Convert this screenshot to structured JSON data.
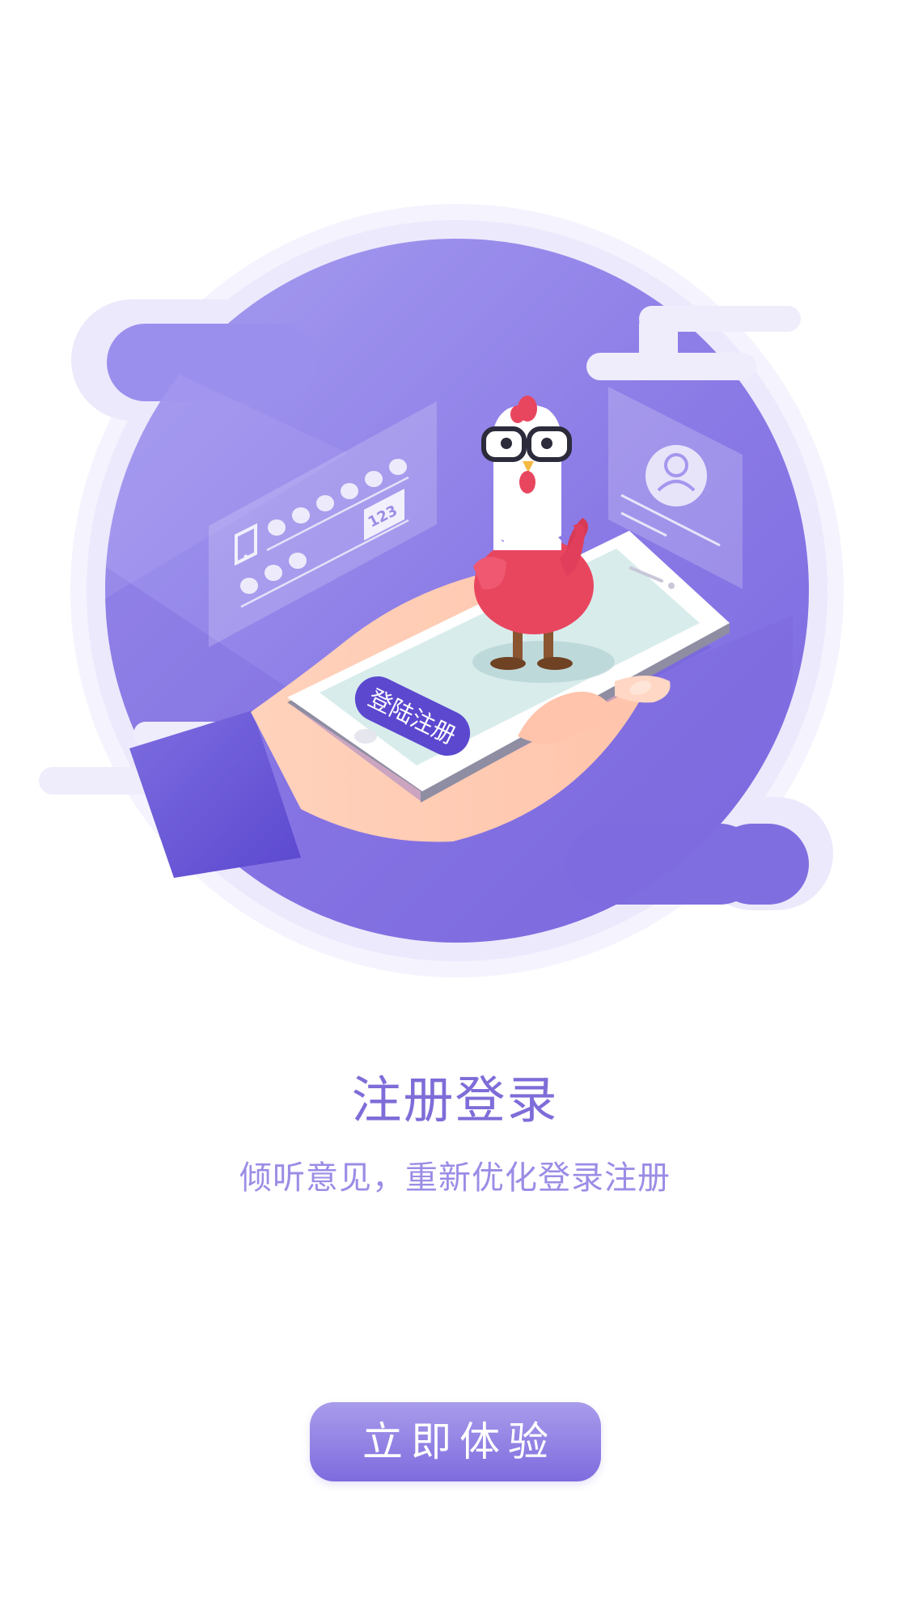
{
  "illustration": {
    "phone_button_label": "登陆注册",
    "keypad_badge": "123"
  },
  "content": {
    "title": "注册登录",
    "subtitle": "倾听意见，重新优化登录注册"
  },
  "cta": {
    "label": "立即体验"
  },
  "colors": {
    "accent": "#8475e0",
    "accent_light": "#a497ee",
    "title": "#7e6dd8",
    "subtitle": "#9a8de6",
    "halo": "#f2f0fd",
    "chicken_body": "#e8465f"
  }
}
